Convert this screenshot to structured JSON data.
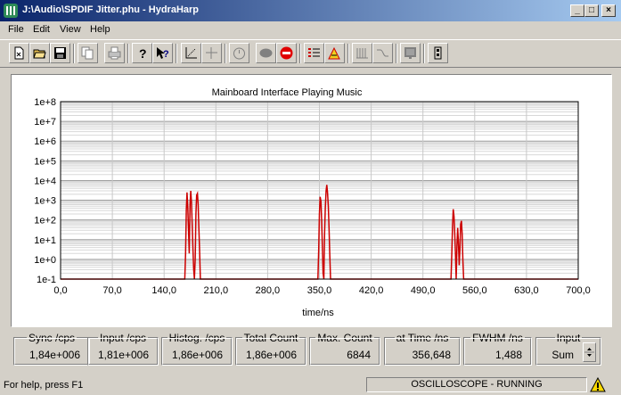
{
  "window": {
    "title": "J:\\Audio\\SPDIF Jitter.phu - HydraHarp",
    "min_label": "_",
    "max_label": "□",
    "close_label": "×"
  },
  "menu": [
    {
      "label": "File"
    },
    {
      "label": "Edit"
    },
    {
      "label": "View"
    },
    {
      "label": "Help"
    }
  ],
  "toolbar": {
    "icons": [
      "new-file-icon",
      "open-folder-icon",
      "save-icon",
      "copy-icon",
      "print-icon",
      "help-icon",
      "context-help-icon",
      "axis-range-icon",
      "crosshair-icon",
      "timer-icon",
      "record-icon",
      "stop-icon",
      "list-settings-icon",
      "peak-icon",
      "channel-select-icon",
      "waveform-icon",
      "display-icon",
      "device-info-icon"
    ]
  },
  "chart_data": {
    "type": "line",
    "title": "Mainboard Interface Playing Music",
    "xlabel": "time/ns",
    "ylabel": "",
    "xlim": [
      0,
      700
    ],
    "ylim_log10": [
      -1,
      8
    ],
    "yscale": "log",
    "grid": true,
    "x_ticks": [
      "0,0",
      "70,0",
      "140,0",
      "210,0",
      "280,0",
      "350,0",
      "420,0",
      "490,0",
      "560,0",
      "630,0",
      "700,0"
    ],
    "y_ticks": [
      "1e+8",
      "1e+7",
      "1e+6",
      "1e+5",
      "1e+4",
      "1e+3",
      "1e+2",
      "1e+1",
      "1e+0",
      "1e-1"
    ],
    "series_color": "#cc0000",
    "series": [
      {
        "points": [
          [
            0,
            0.1
          ],
          [
            168,
            0.1
          ],
          [
            169,
            2
          ],
          [
            170,
            300
          ],
          [
            171,
            2500
          ],
          [
            172,
            400
          ],
          [
            173,
            30
          ],
          [
            174,
            2
          ],
          [
            175,
            600
          ],
          [
            176,
            3000
          ],
          [
            177,
            800
          ],
          [
            178,
            60
          ],
          [
            179,
            3
          ],
          [
            180,
            0.3
          ],
          [
            181,
            0.1
          ],
          [
            182,
            1
          ],
          [
            183,
            200
          ],
          [
            184,
            1800
          ],
          [
            185,
            2200
          ],
          [
            186,
            600
          ],
          [
            187,
            40
          ],
          [
            188,
            3
          ],
          [
            189,
            0.1
          ],
          [
            348,
            0.1
          ],
          [
            349,
            3
          ],
          [
            350,
            200
          ],
          [
            351,
            1500
          ],
          [
            352,
            900
          ],
          [
            353,
            100
          ],
          [
            354,
            5
          ],
          [
            355,
            0.2
          ],
          [
            356,
            0.1
          ],
          [
            357,
            20
          ],
          [
            358,
            400
          ],
          [
            359,
            3000
          ],
          [
            360,
            6000
          ],
          [
            361,
            2500
          ],
          [
            362,
            500
          ],
          [
            363,
            40
          ],
          [
            364,
            2
          ],
          [
            365,
            0.1
          ],
          [
            528,
            0.1
          ],
          [
            529,
            2
          ],
          [
            530,
            50
          ],
          [
            531,
            350
          ],
          [
            532,
            150
          ],
          [
            533,
            20
          ],
          [
            534,
            2
          ],
          [
            535,
            0.1
          ],
          [
            536,
            5
          ],
          [
            537,
            40
          ],
          [
            538,
            8
          ],
          [
            539,
            0.5
          ],
          [
            540,
            3
          ],
          [
            541,
            60
          ],
          [
            542,
            90
          ],
          [
            543,
            20
          ],
          [
            544,
            1
          ],
          [
            545,
            0.1
          ],
          [
            700,
            0.1
          ]
        ]
      }
    ]
  },
  "stats": [
    {
      "label": "Sync /cps",
      "value": "1,84e+006"
    },
    {
      "label": "Input /cps",
      "value": "1,81e+006"
    },
    {
      "label": "Histog. /cps",
      "value": "1,86e+006"
    },
    {
      "label": "Total Count",
      "value": "1,86e+006"
    },
    {
      "label": "Max. Count",
      "value": "6844"
    },
    {
      "label": "at Time /ns",
      "value": "356,648"
    },
    {
      "label": "FWHM  /ns",
      "value": "1,488"
    },
    {
      "label": "Input",
      "value": "Sum"
    }
  ],
  "status": {
    "help_text": "For help, press F1",
    "mode": "OSCILLOSCOPE - RUNNING"
  }
}
